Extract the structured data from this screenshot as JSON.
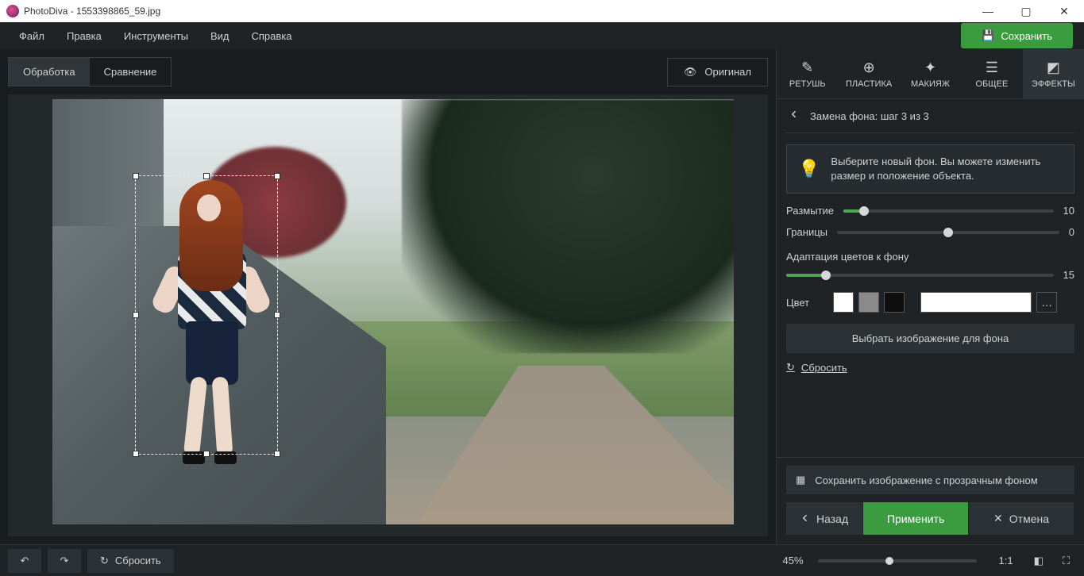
{
  "titlebar": {
    "app": "PhotoDiva",
    "file": "1553398865_59.jpg"
  },
  "menu": {
    "file": "Файл",
    "edit": "Правка",
    "tools": "Инструменты",
    "view": "Вид",
    "help": "Справка",
    "save": "Сохранить"
  },
  "tabs": {
    "process": "Обработка",
    "compare": "Сравнение",
    "original": "Оригинал"
  },
  "tool_tabs": {
    "retouch": "РЕТУШЬ",
    "plastic": "ПЛАСТИКА",
    "makeup": "МАКИЯЖ",
    "general": "ОБЩЕЕ",
    "effects": "ЭФФЕКТЫ"
  },
  "step": {
    "title": "Замена фона: шаг 3 из 3"
  },
  "hint": "Выберите новый фон. Вы можете изменить размер и положение объекта.",
  "sliders": {
    "blur": {
      "label": "Размытие",
      "value": 10,
      "pct": 10
    },
    "borders": {
      "label": "Границы",
      "value": 0,
      "pct": 50
    },
    "adapt": {
      "label": "Адаптация цветов к фону",
      "value": 15,
      "pct": 15
    }
  },
  "color": {
    "label": "Цвет",
    "swatches": [
      "#ffffff",
      "#8a8a8a",
      "#0f0f0f"
    ]
  },
  "buttons": {
    "choose_bg": "Выбрать изображение для фона",
    "reset": "Сбросить",
    "save_transparent": "Сохранить изображение с прозрачным фоном",
    "back": "Назад",
    "apply": "Применить",
    "cancel": "Отмена"
  },
  "bottom": {
    "reset": "Сбросить",
    "zoom": "45%",
    "ratio": "1:1",
    "zoom_pct": 45
  }
}
